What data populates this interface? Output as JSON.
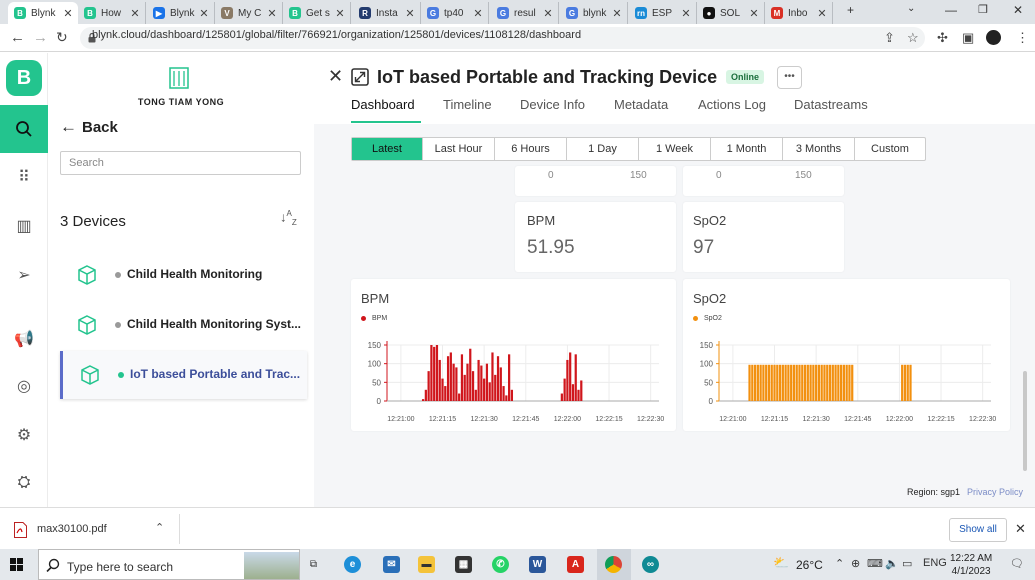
{
  "browser": {
    "tabs": [
      {
        "label": "Blynk",
        "fav": "B",
        "color": "#23c48e"
      },
      {
        "label": "How",
        "fav": "B",
        "color": "#23c48e"
      },
      {
        "label": "Blynk",
        "fav": "▶",
        "color": "#1a73e8"
      },
      {
        "label": "My C",
        "fav": "V",
        "color": "#8a7a66"
      },
      {
        "label": "Get s",
        "fav": "B",
        "color": "#23c48e"
      },
      {
        "label": "Insta",
        "fav": "R",
        "color": "#233b6e"
      },
      {
        "label": "tp40",
        "fav": "G",
        "color": "#4a7be0"
      },
      {
        "label": "resul",
        "fav": "G",
        "color": "#4a7be0"
      },
      {
        "label": "blynk",
        "fav": "G",
        "color": "#4a7be0"
      },
      {
        "label": "ESP",
        "fav": "rn",
        "color": "#1a8bd6"
      },
      {
        "label": "SOL",
        "fav": "●",
        "color": "#111111"
      },
      {
        "label": "Inbo",
        "fav": "M",
        "color": "#d93025"
      }
    ],
    "url": "blynk.cloud/dashboard/125801/global/filter/766921/organization/125801/devices/1108128/dashboard"
  },
  "sidebar": {
    "org_name": "TONG TIAM YONG",
    "back_label": "Back",
    "search_placeholder": "Search",
    "devices_count": "3 Devices",
    "devices": [
      {
        "name": "Child Health Monitoring",
        "status_color": "#9a9a9a"
      },
      {
        "name": "Child Health Monitoring Syst...",
        "status_color": "#9a9a9a"
      },
      {
        "name": "IoT based Portable and Trac...",
        "status_color": "#23c48e"
      }
    ]
  },
  "device": {
    "title": "IoT based Portable and Tracking Device",
    "status": "Online",
    "more": "•••",
    "tabs": [
      "Dashboard",
      "Timeline",
      "Device Info",
      "Metadata",
      "Actions Log",
      "Datastreams"
    ],
    "ranges": [
      "Latest",
      "Last Hour",
      "6 Hours",
      "1 Day",
      "1 Week",
      "1 Month",
      "3 Months",
      "Custom"
    ]
  },
  "gauges": [
    {
      "min": "0",
      "max": "150"
    },
    {
      "min": "0",
      "max": "150"
    }
  ],
  "labels": [
    {
      "label": "BPM",
      "value": "51.95"
    },
    {
      "label": "SpO2",
      "value": "97"
    }
  ],
  "chart_data": [
    {
      "type": "bar",
      "title": "BPM",
      "series": [
        {
          "name": "BPM",
          "color": "#d0161c"
        }
      ],
      "yticks": [
        "150",
        "100",
        "50",
        "0"
      ],
      "ylim": [
        0,
        150
      ],
      "xticks": [
        "12:21:00",
        "12:21:15",
        "12:21:30",
        "12:21:45",
        "12:22:00",
        "12:22:15",
        "12:22:30"
      ],
      "xlim": [
        "12:20:55",
        "12:22:33"
      ],
      "values": [
        [
          "12:21:08",
          5
        ],
        [
          "12:21:09",
          30
        ],
        [
          "12:21:10",
          80
        ],
        [
          "12:21:11",
          150
        ],
        [
          "12:21:12",
          145
        ],
        [
          "12:21:13",
          150
        ],
        [
          "12:21:14",
          110
        ],
        [
          "12:21:15",
          60
        ],
        [
          "12:21:16",
          40
        ],
        [
          "12:21:17",
          120
        ],
        [
          "12:21:18",
          130
        ],
        [
          "12:21:19",
          100
        ],
        [
          "12:21:20",
          90
        ],
        [
          "12:21:21",
          20
        ],
        [
          "12:21:22",
          125
        ],
        [
          "12:21:23",
          70
        ],
        [
          "12:21:24",
          100
        ],
        [
          "12:21:25",
          140
        ],
        [
          "12:21:26",
          80
        ],
        [
          "12:21:27",
          30
        ],
        [
          "12:21:28",
          110
        ],
        [
          "12:21:29",
          95
        ],
        [
          "12:21:30",
          60
        ],
        [
          "12:21:31",
          100
        ],
        [
          "12:21:32",
          50
        ],
        [
          "12:21:33",
          130
        ],
        [
          "12:21:34",
          70
        ],
        [
          "12:21:35",
          120
        ],
        [
          "12:21:36",
          90
        ],
        [
          "12:21:37",
          40
        ],
        [
          "12:21:38",
          15
        ],
        [
          "12:21:39",
          125
        ],
        [
          "12:21:40",
          30
        ],
        [
          "12:21:58",
          20
        ],
        [
          "12:21:59",
          60
        ],
        [
          "12:22:00",
          110
        ],
        [
          "12:22:01",
          130
        ],
        [
          "12:22:02",
          45
        ],
        [
          "12:22:03",
          125
        ],
        [
          "12:22:04",
          30
        ],
        [
          "12:22:05",
          55
        ]
      ]
    },
    {
      "type": "bar",
      "title": "SpO2",
      "series": [
        {
          "name": "SpO2",
          "color": "#f2900f"
        }
      ],
      "yticks": [
        "150",
        "100",
        "50",
        "0"
      ],
      "ylim": [
        0,
        150
      ],
      "xticks": [
        "12:21:00",
        "12:21:15",
        "12:21:30",
        "12:21:45",
        "12:22:00",
        "12:22:15",
        "12:22:30"
      ],
      "xlim": [
        "12:20:55",
        "12:22:33"
      ],
      "values": [
        [
          "12:21:06",
          97
        ],
        [
          "12:21:07",
          97
        ],
        [
          "12:21:08",
          97
        ],
        [
          "12:21:09",
          97
        ],
        [
          "12:21:10",
          97
        ],
        [
          "12:21:11",
          97
        ],
        [
          "12:21:12",
          97
        ],
        [
          "12:21:13",
          97
        ],
        [
          "12:21:14",
          97
        ],
        [
          "12:21:15",
          97
        ],
        [
          "12:21:16",
          97
        ],
        [
          "12:21:17",
          97
        ],
        [
          "12:21:18",
          97
        ],
        [
          "12:21:19",
          97
        ],
        [
          "12:21:20",
          97
        ],
        [
          "12:21:21",
          97
        ],
        [
          "12:21:22",
          97
        ],
        [
          "12:21:23",
          97
        ],
        [
          "12:21:24",
          97
        ],
        [
          "12:21:25",
          97
        ],
        [
          "12:21:26",
          97
        ],
        [
          "12:21:27",
          97
        ],
        [
          "12:21:28",
          97
        ],
        [
          "12:21:29",
          97
        ],
        [
          "12:21:30",
          97
        ],
        [
          "12:21:31",
          97
        ],
        [
          "12:21:32",
          97
        ],
        [
          "12:21:33",
          97
        ],
        [
          "12:21:34",
          97
        ],
        [
          "12:21:35",
          97
        ],
        [
          "12:21:36",
          97
        ],
        [
          "12:21:37",
          97
        ],
        [
          "12:21:38",
          97
        ],
        [
          "12:21:39",
          97
        ],
        [
          "12:21:40",
          97
        ],
        [
          "12:21:41",
          97
        ],
        [
          "12:21:42",
          97
        ],
        [
          "12:21:43",
          97
        ],
        [
          "12:22:01",
          97
        ],
        [
          "12:22:02",
          97
        ],
        [
          "12:22:03",
          97
        ],
        [
          "12:22:04",
          97
        ]
      ]
    }
  ],
  "footer": {
    "region": "Region: sgp1",
    "privacy": "Privacy Policy"
  },
  "download": {
    "filename": "max30100.pdf",
    "show_all": "Show all"
  },
  "taskbar": {
    "search_placeholder": "Type here to search",
    "temp": "26°C",
    "lang": "ENG",
    "time": "12:22 AM",
    "date": "4/1/2023"
  }
}
